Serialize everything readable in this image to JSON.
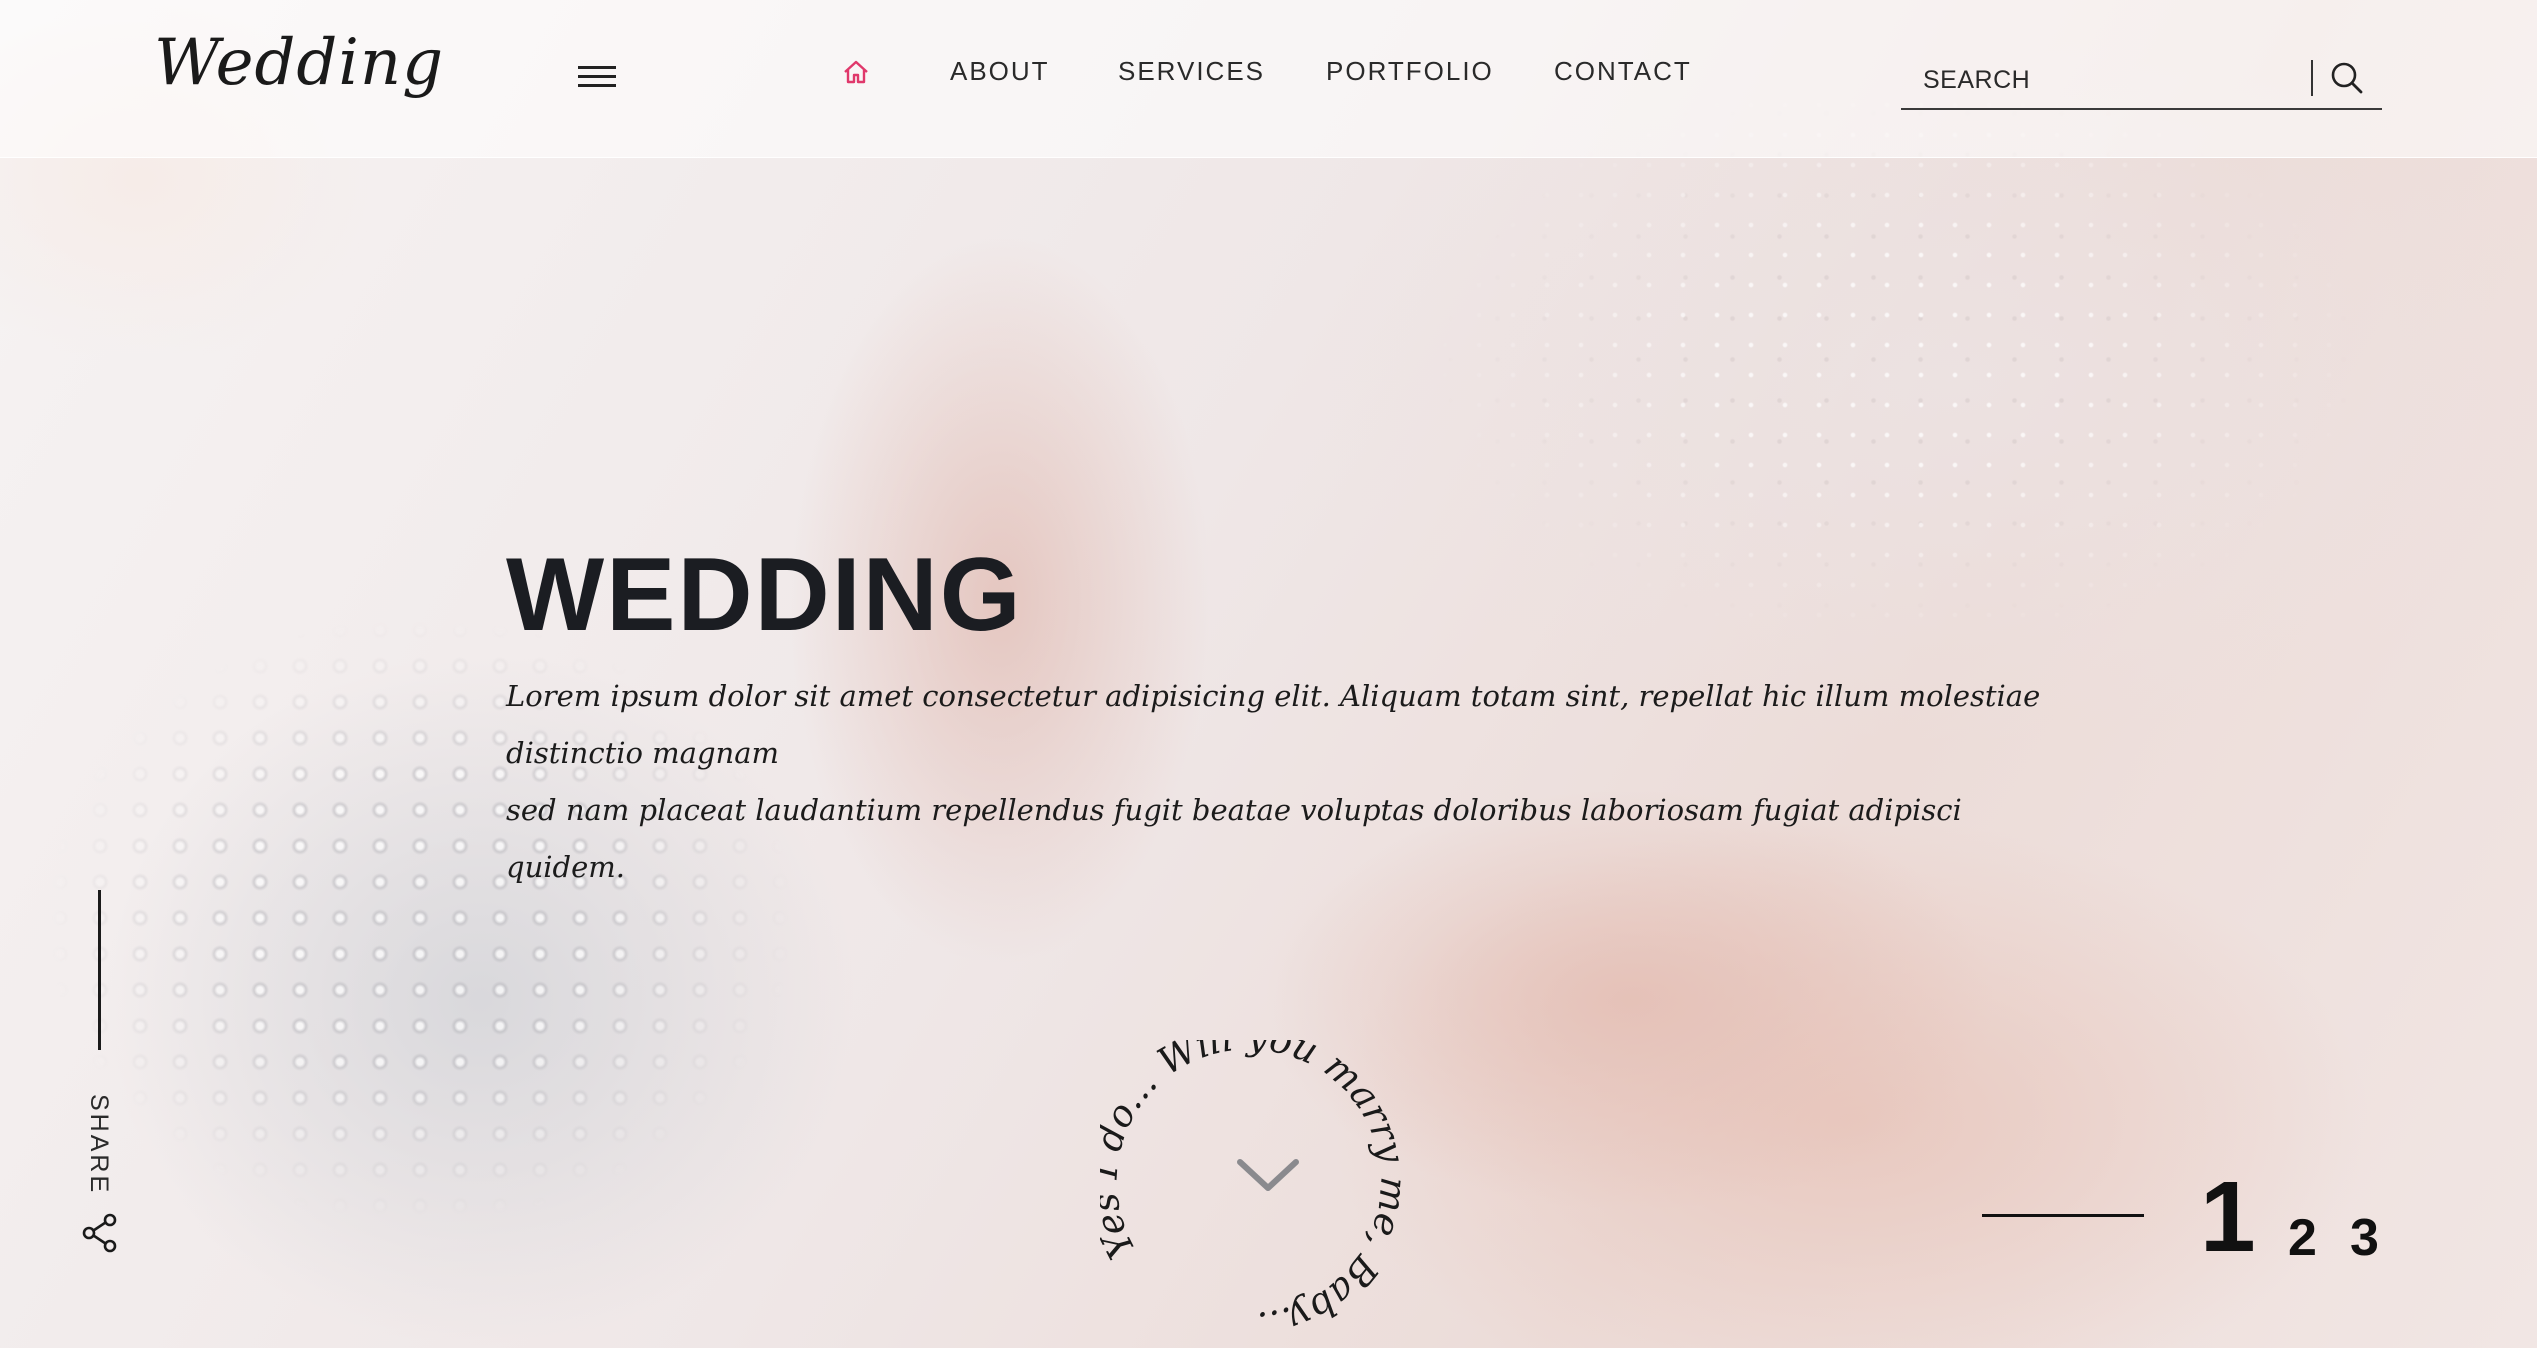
{
  "header": {
    "logo": "Wedding",
    "nav": [
      {
        "label": "ABOUT"
      },
      {
        "label": "SERVICES"
      },
      {
        "label": "PORTFOLIO"
      },
      {
        "label": "CONTACT"
      }
    ],
    "search": {
      "placeholder": "SEARCH"
    }
  },
  "hero": {
    "title": "WEDDING",
    "text_line1": "Lorem ipsum dolor sit amet consectetur adipisicing elit. Aliquam totam sint, repellat hic illum molestiae distinctio magnam",
    "text_line2": "sed nam placeat laudantium repellendus fugit beatae voluptas doloribus laboriosam fugiat adipisci quidem."
  },
  "share": {
    "label": "SHARE"
  },
  "circle_text": "Yes I do... Will you marry me, Baby...",
  "pager": [
    "1",
    "2",
    "3"
  ],
  "active_slide": "1",
  "colors": {
    "accent": "#e0386b",
    "text": "#1b1d22"
  },
  "icons": [
    "home-icon",
    "hamburger-icon",
    "search-icon",
    "share-icon",
    "chevron-down-icon"
  ]
}
